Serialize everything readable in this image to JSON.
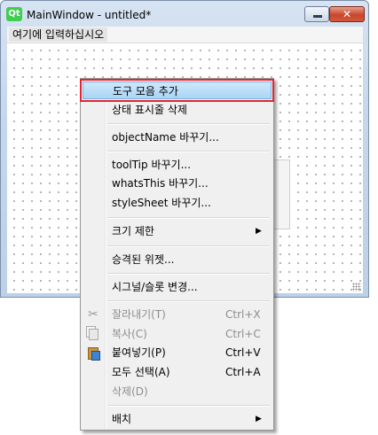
{
  "window": {
    "logo": "Qt",
    "title": "MainWindow - untitled*",
    "minimize_label": "",
    "close_label": "✕"
  },
  "menubar": {
    "placeholder": "여기에 입력하십시오"
  },
  "context_menu": {
    "items": [
      {
        "label": "도구 모음 추가"
      },
      {
        "label": "상태 표시줄 삭제"
      },
      {
        "label": "objectName 바꾸기..."
      },
      {
        "label": "toolTip 바꾸기..."
      },
      {
        "label": "whatsThis 바꾸기..."
      },
      {
        "label": "styleSheet 바꾸기..."
      },
      {
        "label": "크기 제한",
        "submenu_arrow": "▶"
      },
      {
        "label": "승격된 위젯..."
      },
      {
        "label": "시그널/슬롯 변경..."
      },
      {
        "label": "잘라내기(T)",
        "shortcut": "Ctrl+X",
        "icon": "cut-icon",
        "glyph": "✂"
      },
      {
        "label": "복사(C)",
        "shortcut": "Ctrl+C",
        "icon": "copy-icon"
      },
      {
        "label": "붙여넣기(P)",
        "shortcut": "Ctrl+V",
        "icon": "paste-icon"
      },
      {
        "label": "모두 선택(A)",
        "shortcut": "Ctrl+A"
      },
      {
        "label": "삭제(D)"
      },
      {
        "label": "배치",
        "submenu_arrow": "▶"
      }
    ]
  },
  "colors": {
    "highlight_outline": "#e32636",
    "highlight_fill": "#cfe7fb"
  }
}
